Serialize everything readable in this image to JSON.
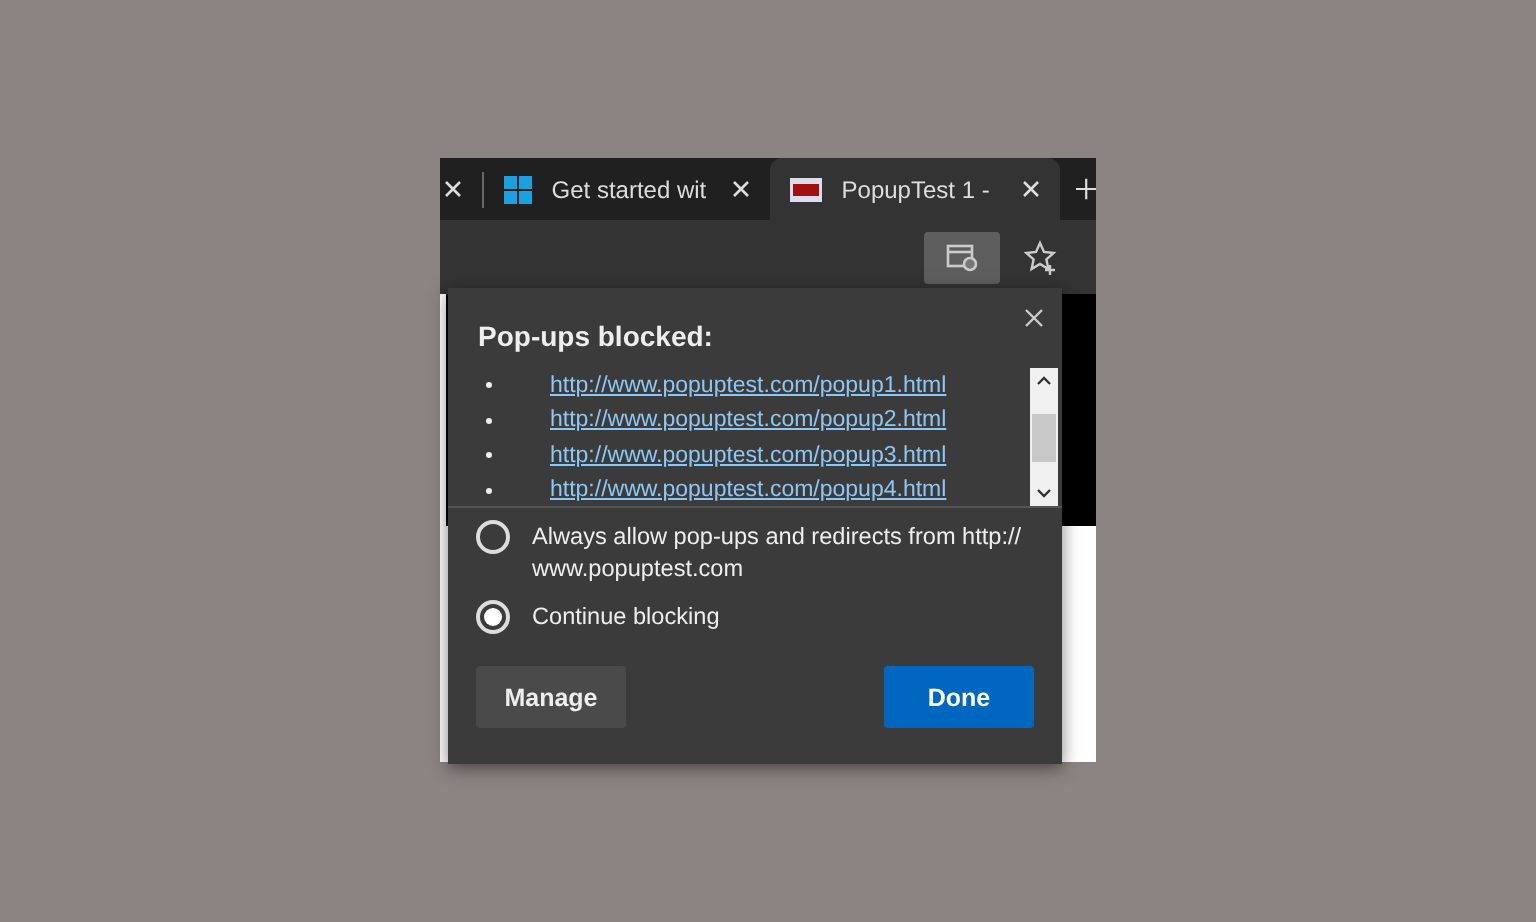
{
  "tabs": [
    {
      "label": "Get started wit",
      "selected": false,
      "kind": "windows"
    },
    {
      "label": "PopupTest 1 -",
      "selected": true,
      "kind": "pop"
    }
  ],
  "popup": {
    "title": "Pop-ups blocked:",
    "links": [
      "http://www.popuptest.com/popup1.html",
      "http://www.popuptest.com/popup2.html",
      "http://www.popuptest.com/popup3.html",
      "http://www.popuptest.com/popup4.html"
    ],
    "options": [
      {
        "label": "Always allow pop-ups and redirects from http:// www.popuptest.com",
        "selected": false
      },
      {
        "label": "Continue blocking",
        "selected": true
      }
    ],
    "buttons": [
      {
        "label": "Manage",
        "kind": "secondary"
      },
      {
        "label": "Done",
        "kind": "primary"
      }
    ]
  }
}
